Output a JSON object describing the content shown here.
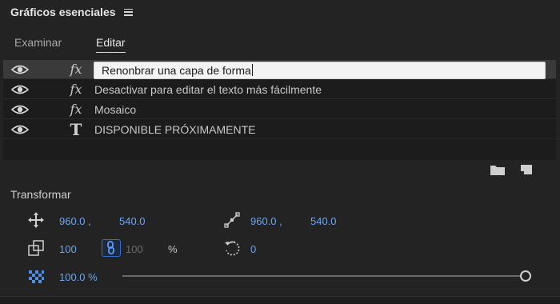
{
  "panel": {
    "title": "Gráficos esenciales"
  },
  "tabs": [
    {
      "label": "Examinar",
      "active": false
    },
    {
      "label": "Editar",
      "active": true
    }
  ],
  "layers": [
    {
      "type": "fx",
      "type_glyph": "fx",
      "label": "Renonbrar una capa de forma",
      "selected": true,
      "editing": true
    },
    {
      "type": "fx",
      "type_glyph": "fx",
      "label": "Desactivar para editar el texto más fácilmente",
      "selected": false
    },
    {
      "type": "fx",
      "type_glyph": "fx",
      "label": "Mosaico",
      "selected": false
    },
    {
      "type": "text",
      "type_glyph": "T",
      "label": "DISPONIBLE PRÓXIMAMENTE",
      "selected": false
    }
  ],
  "layer_tools": {
    "new_group_icon": "folder-icon",
    "new_layer_icon": "new-item-icon"
  },
  "transform": {
    "title": "Transformar",
    "position": {
      "x": "960.0 ,",
      "y": "540.0",
      "icon": "move-icon"
    },
    "anchor": {
      "x": "960.0 ,",
      "y": "540.0",
      "icon": "anchor-point-icon"
    },
    "scale": {
      "width": "100",
      "height": "100",
      "unit": "%",
      "icon": "scale-icon",
      "linked": true
    },
    "rotation": {
      "value": "0",
      "icon": "rotation-icon"
    },
    "opacity": {
      "value": "100.0 %",
      "fraction": 1.0,
      "icon": "opacity-icon"
    }
  },
  "colors": {
    "accent": "#6ea4ea",
    "selected_row": "#3a3a3a",
    "panel_bg": "#232323"
  }
}
